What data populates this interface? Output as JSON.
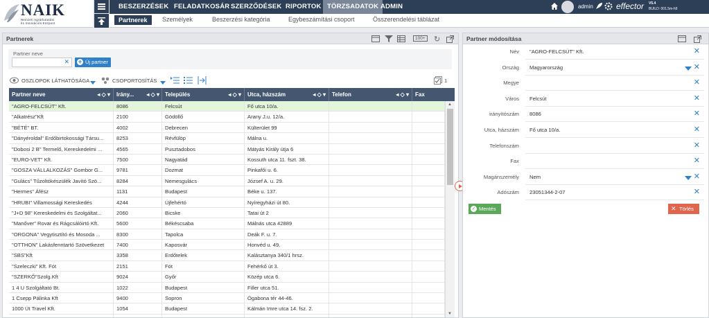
{
  "logo": {
    "name": "NAIK",
    "subtitle_line1": "Nemzeti Agrárkutatási",
    "subtitle_line2": "és Innovációs Központ"
  },
  "topnav": [
    {
      "label": "BESZERZÉSEK"
    },
    {
      "label": "FELADATKOSÁR"
    },
    {
      "label": "SZERZŐDÉSEK"
    },
    {
      "label": "RIPORTOK"
    },
    {
      "label": "TÖRZSADATOK",
      "active": true
    },
    {
      "label": "ADMIN"
    }
  ],
  "user": {
    "name": "admin",
    "brand": "effector",
    "version": "V5.4",
    "build": "BUILD: 001.5m-h9"
  },
  "subnav": [
    {
      "label": "Partnerek",
      "active": true
    },
    {
      "label": "Személyek"
    },
    {
      "label": "Beszerzési kategória"
    },
    {
      "label": "Egybeszámítási csoport"
    },
    {
      "label": "Összerendelési táblázat"
    }
  ],
  "left_panel": {
    "title": "Partnerek",
    "header_badge": "100+",
    "filter_label": "Partner neve",
    "filter_value": "",
    "new_partner_label": "Új partner",
    "columns_visibility_label": "OSZLOPOK LÁTHATÓSÁGA",
    "grouping_label": "CSOPORTOSÍTÁS",
    "selected_count": "1",
    "columns": [
      {
        "label": "Partner neve"
      },
      {
        "label": "Irány..."
      },
      {
        "label": "Település"
      },
      {
        "label": "Utca, házszám"
      },
      {
        "label": "Telefon"
      },
      {
        "label": "Fax"
      }
    ],
    "rows": [
      [
        "\"AGRO-FELCSÚT\" Kft.",
        "8086",
        "Felcsút",
        "Fő utca 10/a.",
        "",
        ""
      ],
      [
        "\"Alkatrész\"Kft",
        "2100",
        "Gödöllő",
        "Arany J.u. 12/a.",
        "",
        ""
      ],
      [
        "\"BÉTÉ\" BT.",
        "4002",
        "Debrecen",
        "Külterület 99",
        "",
        ""
      ],
      [
        "\"Dányéroldal\" Erdőbirtokossági Társu...",
        "8253",
        "Révfülöp",
        "Málna u.",
        "",
        ""
      ],
      [
        "\"Dobosi 2 B\" Termelő, Kereskedelmi ...",
        "4565",
        "Pusztadobos",
        "Mátyás Király útja 6",
        "",
        ""
      ],
      [
        "\"EURO-VET\" Kft.",
        "7500",
        "Nagyatád",
        "Kossuth utca 11. fszt. 38.",
        "",
        ""
      ],
      [
        "\"GOSZA VÁLLALKOZÁS\" Gombor G...",
        "9781",
        "Dozmat",
        "Pinkafői u. 6.",
        "",
        ""
      ],
      [
        "\"Gulács\" Tűzoltókészülék Javító Szö...",
        "8284",
        "Nemesgulács",
        "József A. u. 29.",
        "",
        ""
      ],
      [
        "\"Hermes\" Áfész",
        "1131",
        "Budapest",
        "Béke u. 137.",
        "",
        ""
      ],
      [
        "\"HRUBI\" Villamossági Kereskedés",
        "4244",
        "Újfehértó",
        "Nyíregyházi út 80.",
        "",
        ""
      ],
      [
        "\"J+D 98\" Kereskedelmi és Szolgáltat...",
        "2060",
        "Bicske",
        "Tatai út 2",
        "",
        ""
      ],
      [
        "\"Manőver\" Rovar és Rágcsálóirtó Kft.",
        "5600",
        "Békéscsaba",
        "Málnás utca 42889",
        "",
        ""
      ],
      [
        "\"ORGONA\" Vegytisztító és Mosoda ...",
        "8300",
        "Tapolca",
        "Deák F. u. 7.",
        "",
        ""
      ],
      [
        "\"OTTHON\" Lakásfenntartó Szövetkezet",
        "7400",
        "Kaposvár",
        "Honvéd u. 49.",
        "",
        ""
      ],
      [
        "\"SBS\"Kft",
        "3358",
        "Erdőtelek",
        "Kalásztanya 340/1 hrsz.",
        "",
        ""
      ],
      [
        "\"Szeleczki\" Kft. Fót",
        "2151",
        "Fót",
        "Fehérkő út 3.",
        "",
        ""
      ],
      [
        "\"SZERKŐ\"Szolg.Kft",
        "9024",
        "Győr",
        "Közép utca 6.",
        "",
        ""
      ],
      [
        "1 4 U Szolgáltató Bt.",
        "1022",
        "Budapest",
        "Filler utca 51.",
        "",
        ""
      ],
      [
        "1 Csepp Pálinka Kft",
        "9400",
        "Sopron",
        "Ógabona tér 44-46.",
        "",
        ""
      ],
      [
        "1000 Út Travel Kft.",
        "1054",
        "Budapest",
        "Kálmán Imre utca 14. fsz. 2.",
        "",
        ""
      ],
      [
        "10GHz Kft.",
        "5540",
        "Szarvas",
        "Arany János utca 34.",
        "",
        ""
      ]
    ]
  },
  "right_panel": {
    "title": "Partner módosítása",
    "fields": [
      {
        "label": "Név",
        "value": "\"AGRO-FELCSÚT\" Kft."
      },
      {
        "label": "Ország",
        "value": "Magyarország",
        "dropdown": true
      },
      {
        "label": "Megye",
        "value": ""
      },
      {
        "label": "Város",
        "value": "Felcsút"
      },
      {
        "label": "irányítószám",
        "value": "8086"
      },
      {
        "label": "Utca, házszám",
        "value": "Fő utca 10/a."
      },
      {
        "label": "Telefonszám",
        "value": ""
      },
      {
        "label": "Fax",
        "value": ""
      },
      {
        "label": "Magánszemély",
        "value": "Nem",
        "dropdown": true
      },
      {
        "label": "Adószám",
        "value": "23051344-2-07"
      }
    ],
    "save_label": "Mentés",
    "delete_label": "Törlés"
  },
  "colors": {
    "nav": "#2d3e57",
    "active_nav": "#7a8799",
    "grid_header": "#455670",
    "selected_row": "#e3f5da",
    "save": "#5aa85a",
    "delete": "#e0654f",
    "accent": "#2f80c8",
    "expand_toggle": "#e0654f"
  }
}
